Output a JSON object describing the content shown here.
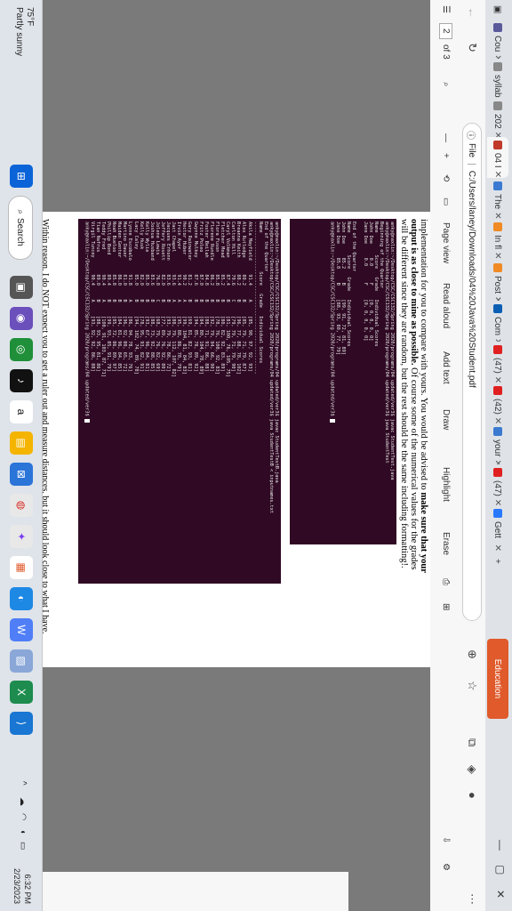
{
  "tabs": [
    {
      "label": "Cou",
      "color": "#5a5a9a"
    },
    {
      "label": "syllab",
      "color": "#888888"
    },
    {
      "label": "202",
      "color": "#888888"
    },
    {
      "label": "04 I",
      "color": "#c0392b"
    },
    {
      "label": "The",
      "color": "#3c7ad1"
    },
    {
      "label": "In fl",
      "color": "#f08a24"
    },
    {
      "label": "Post",
      "color": "#f08a24"
    },
    {
      "label": "Com",
      "color": "#0a5fb4"
    },
    {
      "label": "(47)",
      "color": "#e02020"
    },
    {
      "label": "(42)",
      "color": "#e02020"
    },
    {
      "label": "your",
      "color": "#3c7ad1"
    },
    {
      "label": "(47)",
      "color": "#e02020"
    },
    {
      "label": "Gett",
      "color": "#2979ff"
    }
  ],
  "addressbar": {
    "prefix": "File",
    "url": "C:/Users/laney/Downloads/04%20Java%20Student.pdf"
  },
  "pdf_toolbar": {
    "page": "2",
    "of": "of 3",
    "page_view": "Page view",
    "read_aloud": "Read aloud",
    "add_text": "Add text",
    "draw": "Draw",
    "highlight": "Highlight",
    "erase": "Erase"
  },
  "document": {
    "para_l1_a": "implementation for you to compare with yours. You would be advised to ",
    "para_l1_b": "make sure that your",
    "para_l2_a": "output is as close to mine as possible.",
    "para_l2_b": " Of course some of the numerical values for the grades",
    "para_l3": "will be different since they are random, but the rest should be the same including formatting!.",
    "terminal1": "anky@naxlin:~/Desktop/CSC/CSC132/Spring 2020/programs/04 updated/ver3$ javac StudentTest.java\nanky@naxlin:~/Desktop/CSC/CSC132/Spring 2020/programs/04 updated/ver3$ java StudentTest\nBeginning of the Quarter\nName        Score   Grade   Individual Scores\nJohn Doe     0.0      F     [0, 0, 0, 0, 0]\nJane Doe     0.0      F     [0, 0, 0, 0, 0]\n\nEnd of the Quarter\nName        Score   Grade   Individual Scores\nJohn Doe     85.2     B     [99, 91, 72, 81, 89]\nJane Doe     85.8     B     [88, 93, 80, 77, 79]\nanky@naxlin:~/Desktop/CSC/CSC132/Spring 2020/programs/04 updated/ver3$ ",
    "terminal2": "anky@naxlin:~/Desktop/CSC/CSC132/Spring 2020/programs/04 updated/ver3$ javac StudentTestB.java\nanky@naxlin:~/Desktop/CSC/CSC132/Spring 2020/programs/04 updated/ver3$ java StudentTestB < inputnames.txt\nEnd of the Quarter\nName              Score   Grade   Individual Scores\n-------------------------------------------------------\nAkila Mayfield     91.4     A     [85, 90, 97, 92, 93]\nAlex Rutledge      80.2     B     [85, 79, 71, 79, 87]\nBreanna Keith      88.2     B     [96, 77, 88, 78, 102]\nCarlton Hill       79.6     C     [79, 79, 71, 79, 90]\nCaryl Volkman      87.4     B     [81, 100, 76, 105, 75]\nFletcher Mead      85.2     B     [80, 82, 92, 83, 89]\nFlora Fuson        85.8     B     [78, 76, 100, 92, 83]\nFlorene Rundle     86.2     B     [92, 79, 94, 66, 90]\nFoster Beilah      84.8     B     [88, 71, 91, 86, 88]\nFritz Poleo        87.0     B     [84, 80, 104, 78, 89]\nGwynne Mulkey      87.6     B     [94, 85, 78, 89, 92]\nGary Rainwater     81.2     B     [69, 81, 82, 93, 81]\nHector Huber       90.2     A     [99, 104, 81, 84, 83]\nIrvin Ayer         91.4     A     [95, 88, 86, 78, 79]\nJact Chapel        93.6     A     [88, 79, 112, 107, 82]\nJacques Erhonn     83.6     B     [93, 79, 78, 86, 72]\nJeffery Rosett     82.0     B     [77, 89, 76, 92, 80]\nJolene Lewis       76.8     C     [68, 79, 76, 82, 69]\nJoshua Husband     83.6     B     [88, 73, 92, 88, 85]\nKelly Wylie        85.0     B     [93, 67, 96, 84, 81]\nKelly Husk         82.0     B     [78, 95, 93, 82, 91]\nLacy Caley         85.0     B     [94, 102, 74, 89, 78]\nLynne Escobalo     91.8     A     [86, 94, 78, 93, 76]\nMartino Dauer      81.0     B     [96, 92, 80, 65, 72]\nMaiden Genter      86.0     B     [84, 81, 96, 84, 85]\nNoah Bueloo        85.8     B     [85, 72, 86, 89, 97]\nPhillip Bond       89.4     B     [99, 93, 85, 91, 79]\nTeddy Fred         90.4     A     [100, 91, 103, 87, 71]\nTian Nafrus        89.0     B     [88, 93, 95, 81, 86]\nVirgil Tuncey      90.4     A     [93, 92, 92, 86, 88]\nanky@naxlin:~/Desktop/CSC/CSC132/Spring 2020/programs/04 updated/ver3$ ",
    "footer": "Within reason, I do NOT expect you to get a ruler out and measure distances, but it should look close to what I have."
  },
  "taskbar": {
    "weather_temp": "75°F",
    "weather_desc": "Partly sunny",
    "search": "Search",
    "time": "6:32 PM",
    "date": "2/23/2023"
  },
  "colors": {
    "terminal_bg": "#300a24",
    "education_tab": "#e05a2b"
  }
}
